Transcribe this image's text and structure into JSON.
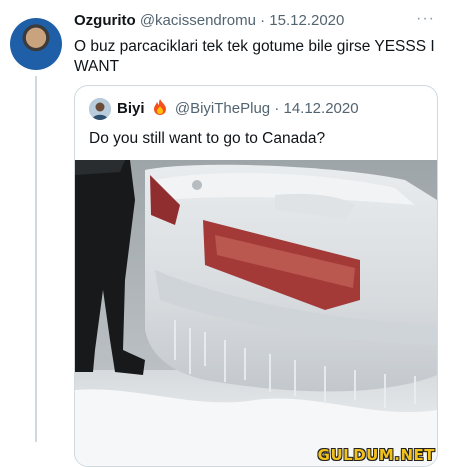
{
  "tweet": {
    "author_name": "Ozgurito",
    "author_handle": "@kacissendromu",
    "separator": "·",
    "date": "15.12.2020",
    "text": "O buz parcaciklari tek tek gotume bile girse YESSS I WANT",
    "more_icon": "more-icon",
    "avatar_icon": "avatar"
  },
  "quoted_tweet": {
    "author_name": "Biyi",
    "author_emoji_icon": "fire-emoji-icon",
    "author_handle": "@BiyiThePlug",
    "separator": "·",
    "date": "14.12.2020",
    "text": "Do you still want to go to Canada?",
    "media_description_icon": "frozen-car-photo"
  },
  "watermark": "GULDUM.NET",
  "colors": {
    "text": "#0f1419",
    "secondary": "#536471",
    "border": "#cfd9de",
    "watermark": "#f2c21b"
  }
}
